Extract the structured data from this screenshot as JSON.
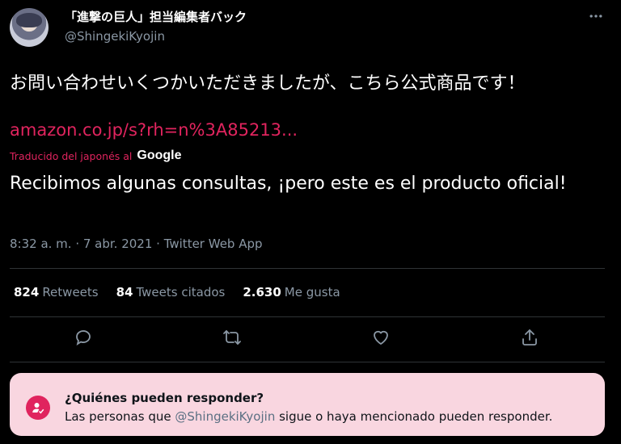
{
  "author": {
    "display_name": "「進撃の巨人」担当編集者バック",
    "handle": "@ShingekiKyojin"
  },
  "tweet": {
    "text": "お問い合わせいくつかいただきましたが、こちら公式商品です！",
    "link": "amazon.co.jp/s?rh=n%3A85213...",
    "translated_from": "Traducido del japonés al",
    "translator_brand": "Google",
    "translation": "Recibimos algunas consultas, ¡pero este es el producto oficial!",
    "meta": "8:32 a. m. · 7 abr. 2021 · Twitter Web App"
  },
  "stats": [
    {
      "count": "824",
      "label": "Retweets"
    },
    {
      "count": "84",
      "label": "Tweets citados"
    },
    {
      "count": "2.630",
      "label": "Me gusta"
    }
  ],
  "actions": [
    "reply-icon",
    "retweet-icon",
    "like-icon",
    "share-icon"
  ],
  "reply_restriction": {
    "title": "¿Quiénes pueden responder?",
    "prefix": "Las personas que",
    "mention": "@ShingekiKyojin",
    "suffix": "sigue o haya mencionado pueden responder."
  },
  "colors": {
    "accent": "#e0245e",
    "background": "#000000",
    "secondary_text": "#8b98a5",
    "reply_box_bg": "#f9d6e0"
  }
}
